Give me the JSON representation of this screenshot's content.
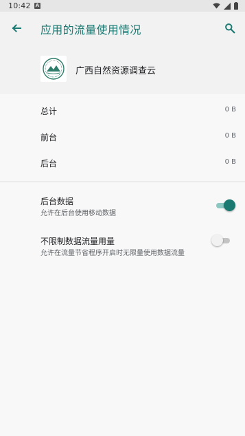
{
  "status_bar": {
    "time": "10:42",
    "notification_icon": "A"
  },
  "app_bar": {
    "title": "应用的流量使用情况",
    "back_icon": "arrow-left",
    "search_icon": "search",
    "accent_color": "#1a7a72"
  },
  "app": {
    "name": "广西自然资源调查云"
  },
  "usage": {
    "rows": [
      {
        "label": "总计",
        "value": "0 B"
      },
      {
        "label": "前台",
        "value": "0 B"
      },
      {
        "label": "后台",
        "value": "0 B"
      }
    ]
  },
  "settings": {
    "background_data": {
      "title": "后台数据",
      "summary": "允许在后台使用移动数据",
      "enabled": true
    },
    "unrestricted_data": {
      "title": "不限制数据流量用量",
      "summary": "允许在流量节省程序开启时无限量使用数据流量",
      "enabled": false
    }
  }
}
